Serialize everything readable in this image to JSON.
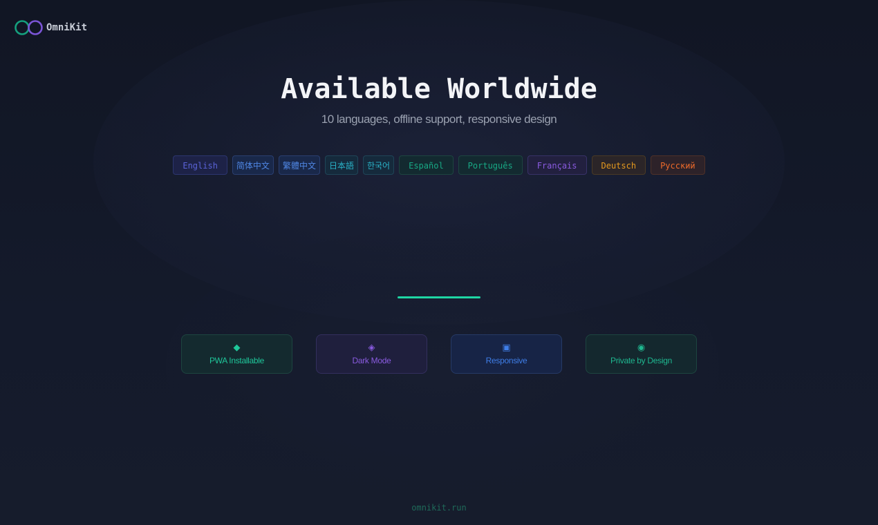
{
  "brand": {
    "name": "OmniKit",
    "colors": {
      "left_ring": "#15a07e",
      "right_ring": "#7b55d6"
    }
  },
  "hero": {
    "title": "Available Worldwide",
    "subtitle": "10 languages, offline support, responsive design"
  },
  "languages": [
    {
      "label": "English",
      "color": "#5a63d8",
      "bg": "#1d2247",
      "border": "#2c3570"
    },
    {
      "label": "简体中文",
      "color": "#4f86e3",
      "bg": "#19284a",
      "border": "#2a3f70",
      "cjk": true
    },
    {
      "label": "繁體中文",
      "color": "#4f86e3",
      "bg": "#19284a",
      "border": "#2a3f70",
      "cjk": true
    },
    {
      "label": "日本語",
      "color": "#2ab2c8",
      "bg": "#152a3c",
      "border": "#1f4558",
      "cjk": true
    },
    {
      "label": "한국어",
      "color": "#2ab2c8",
      "bg": "#152a3c",
      "border": "#1f4558",
      "cjk": true
    },
    {
      "label": "Español",
      "color": "#18a985",
      "bg": "#132a30",
      "border": "#1d4540"
    },
    {
      "label": "Português",
      "color": "#18a985",
      "bg": "#132a30",
      "border": "#1d4540"
    },
    {
      "label": "Français",
      "color": "#8a5be0",
      "bg": "#22203f",
      "border": "#383268"
    },
    {
      "label": "Deutsch",
      "color": "#e69a1e",
      "bg": "#2b2528",
      "border": "#4a3a24"
    },
    {
      "label": "Русский",
      "color": "#ec6a2a",
      "bg": "#2d2229",
      "border": "#4f3128"
    }
  ],
  "divider_color": "#1ed6a4",
  "features": [
    {
      "icon": "◆",
      "icon_name": "diamond-icon",
      "label": "PWA Installable",
      "color": "#1fc79a",
      "bg": "#142a2f",
      "border": "#1d4540"
    },
    {
      "icon": "◈",
      "icon_name": "diamond-outline-icon",
      "label": "Dark Mode",
      "color": "#8a5be0",
      "bg": "#1f1f3d",
      "border": "#332f5e"
    },
    {
      "icon": "▣",
      "icon_name": "square-icon",
      "label": "Responsive",
      "color": "#3f7ee8",
      "bg": "#172446",
      "border": "#263a66"
    },
    {
      "icon": "◉",
      "icon_name": "circle-icon",
      "label": "Private by Design",
      "color": "#1fb890",
      "bg": "#14282e",
      "border": "#1d4540"
    }
  ],
  "footer": {
    "url": "omnikit.run"
  }
}
